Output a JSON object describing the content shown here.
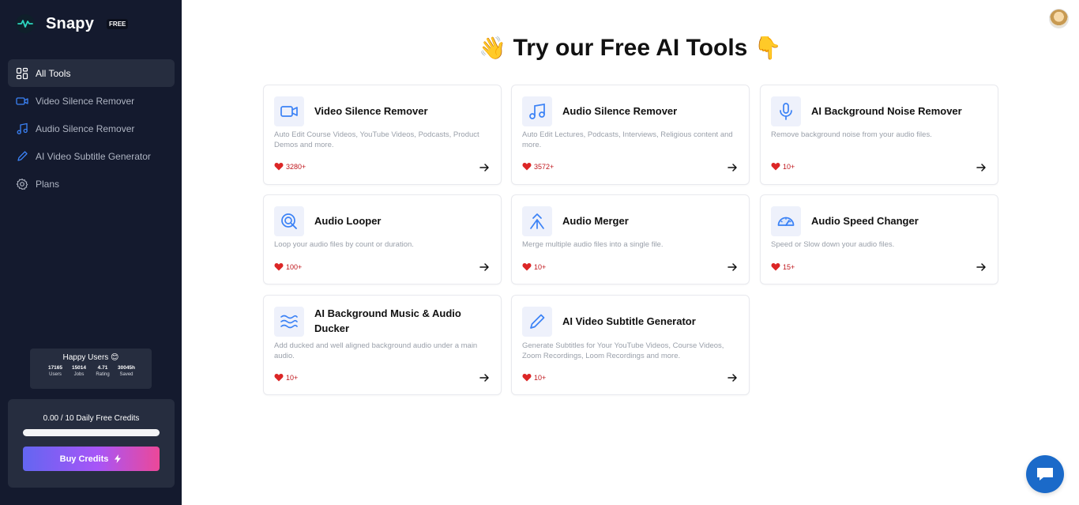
{
  "brand": {
    "name": "Snapy",
    "badge": "FREE"
  },
  "sidebar": {
    "items": [
      {
        "label": "All Tools",
        "icon": "grid-icon",
        "active": true
      },
      {
        "label": "Video Silence Remover",
        "icon": "video-camera-icon"
      },
      {
        "label": "Audio Silence Remover",
        "icon": "music-note-icon"
      },
      {
        "label": "AI Video Subtitle Generator",
        "icon": "pencil-icon"
      },
      {
        "label": "Plans",
        "icon": "gear-icon"
      }
    ],
    "stats": {
      "title": "Happy Users 😊",
      "items": [
        {
          "value": "17165",
          "label": "Users"
        },
        {
          "value": "15014",
          "label": "Jobs"
        },
        {
          "value": "4.71",
          "label": "Rating"
        },
        {
          "value": "30045h",
          "label": "Saved"
        }
      ]
    },
    "credits": {
      "text": "0.00 / 10 Daily Free Credits",
      "used_fraction": 0,
      "button_label": "Buy Credits"
    }
  },
  "main": {
    "heading_left_emoji": "👋",
    "heading": "Try our Free AI Tools",
    "heading_right_emoji": "👇",
    "cards": [
      {
        "title": "Video Silence Remover",
        "description": "Auto Edit Course Videos, YouTube Videos, Podcasts, Product Demos and more.",
        "likes": "3280+",
        "icon": "video-camera-icon"
      },
      {
        "title": "Audio Silence Remover",
        "description": "Auto Edit Lectures, Podcasts, Interviews, Religious content and more.",
        "likes": "3572+",
        "icon": "music-note-icon"
      },
      {
        "title": "AI Background Noise Remover",
        "description": "Remove background noise from your audio files.",
        "likes": "10+",
        "icon": "microphone-icon"
      },
      {
        "title": "Audio Looper",
        "description": "Loop your audio files by count or duration.",
        "likes": "100+",
        "icon": "loop-icon"
      },
      {
        "title": "Audio Merger",
        "description": "Merge multiple audio files into a single file.",
        "likes": "10+",
        "icon": "merge-icon"
      },
      {
        "title": "Audio Speed Changer",
        "description": "Speed or Slow down your audio files.",
        "likes": "15+",
        "icon": "speedometer-icon"
      },
      {
        "title": "AI Background Music & Audio Ducker",
        "description": "Add ducked and well aligned background audio under a main audio.",
        "likes": "10+",
        "icon": "waves-icon"
      },
      {
        "title": "AI Video Subtitle Generator",
        "description": "Generate Subtitles for Your YouTube Videos, Course Videos, Zoom Recordings, Loom Recordings and more.",
        "likes": "10+",
        "icon": "pencil-icon"
      }
    ]
  },
  "colors": {
    "sidebar_bg": "#141a2e",
    "accent_blue": "#3b82f6",
    "heart_red": "#dc2626",
    "chat_blue": "#1b6ac9"
  }
}
